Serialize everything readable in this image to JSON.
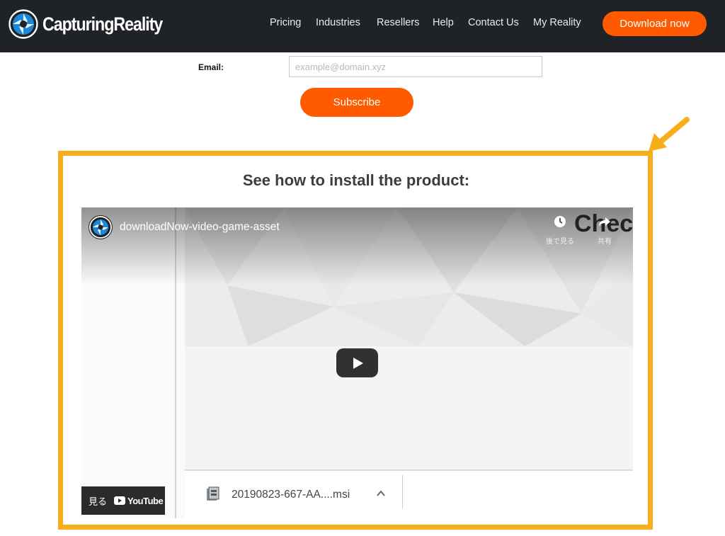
{
  "header": {
    "brand": "CapturingReality",
    "nav": [
      "Pricing",
      "Industries",
      "Resellers",
      "Help",
      "Contact Us",
      "My Reality"
    ],
    "cta": "Download now"
  },
  "subscribe": {
    "email_label": "Email:",
    "email_placeholder": "example@domain.xyz",
    "button": "Subscribe"
  },
  "section": {
    "title": "See how to install the product:"
  },
  "video": {
    "title": "downloadNow-video-game-asset",
    "watch_later_label": "後で見る",
    "share_label": "共有",
    "overlay_text": "Chec",
    "youtube_watch_label": "見る",
    "youtube_label": "YouTube",
    "download_file": "20190823-667-AA....msi"
  },
  "colors": {
    "header_bg": "#1f2227",
    "accent_orange": "#ff5a00",
    "highlight_yellow": "#f6ae1b"
  },
  "icons": {
    "logo": "aperture-logo-icon",
    "arrow": "callout-arrow-icon",
    "clock": "clock-icon",
    "share": "share-icon",
    "play": "play-icon",
    "file": "installer-file-icon",
    "chevron": "chevron-up-icon"
  }
}
